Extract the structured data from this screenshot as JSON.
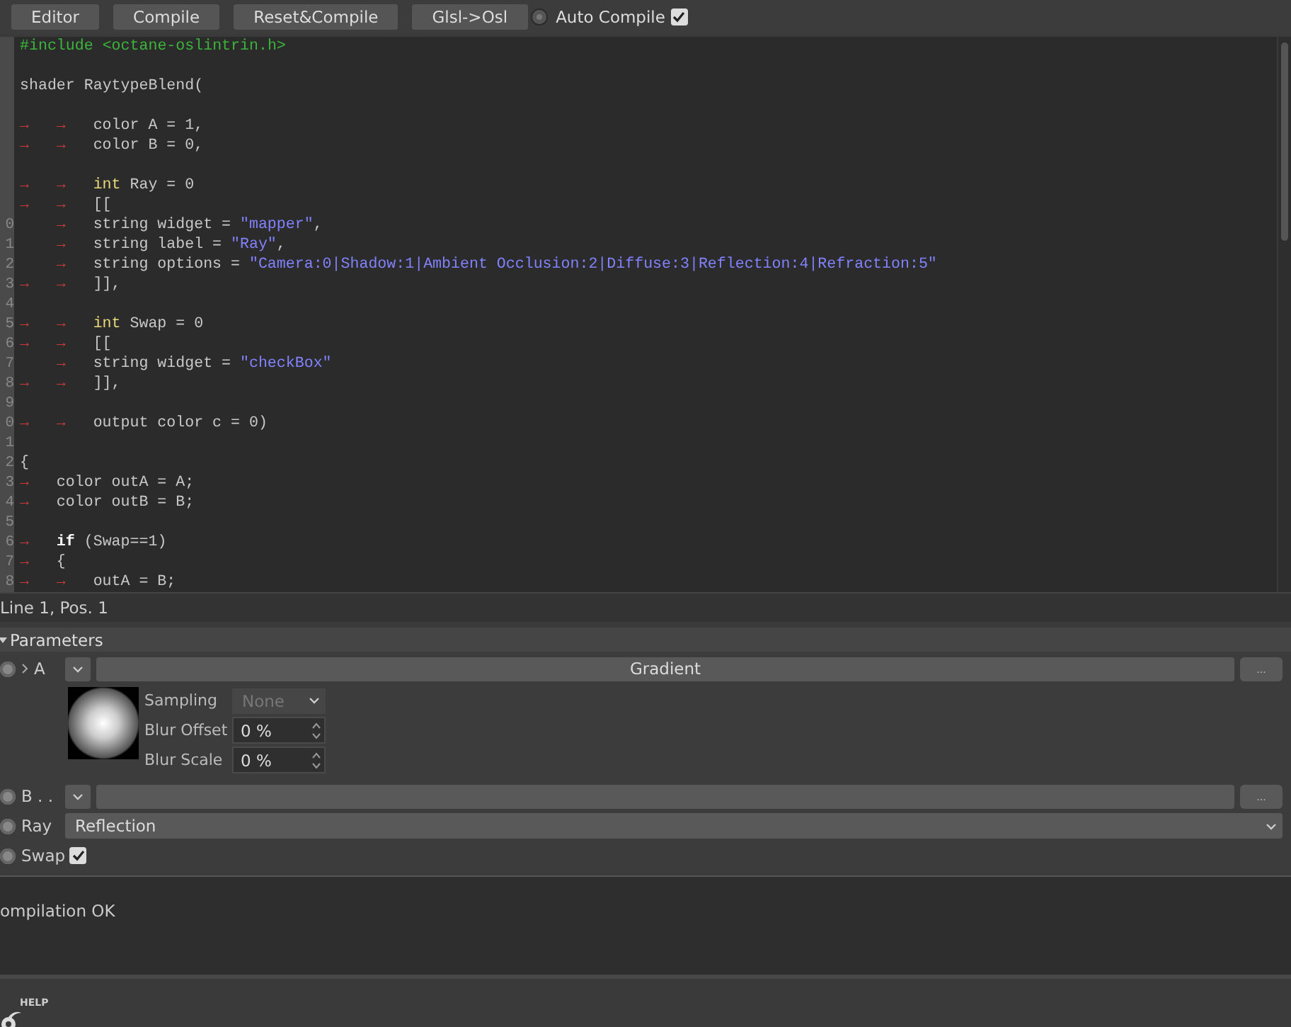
{
  "toolbar": {
    "buttons": [
      "Editor",
      "Compile",
      "Reset&Compile",
      "Glsl->Osl"
    ],
    "toggle": {
      "on": false
    },
    "auto_compile": {
      "label": "Auto Compile",
      "checked": true
    }
  },
  "editor": {
    "lines": [
      {
        "tokens": [
          {
            "kind": "include",
            "text": "#include <octane-oslintrin.h>"
          }
        ]
      },
      {
        "kind": "blank"
      },
      {
        "tokens": [
          {
            "kind": "plain",
            "text": "shader RaytypeBlend("
          }
        ]
      },
      {
        "kind": "blank"
      },
      {
        "tokens": [
          {
            "kind": "tab",
            "text": "→"
          },
          {
            "kind": "tab",
            "text": "→"
          },
          {
            "kind": "plain",
            "text": "color A = 1,"
          }
        ]
      },
      {
        "tokens": [
          {
            "kind": "tab",
            "text": "→"
          },
          {
            "kind": "tab",
            "text": "→"
          },
          {
            "kind": "plain",
            "text": "color B = 0,"
          }
        ]
      },
      {
        "kind": "blank"
      },
      {
        "tokens": [
          {
            "kind": "tab",
            "text": "→"
          },
          {
            "kind": "tab",
            "text": "→"
          },
          {
            "kind": "type",
            "text": "int"
          },
          {
            "kind": "plain",
            "text": " Ray = 0"
          }
        ]
      },
      {
        "tokens": [
          {
            "kind": "tab",
            "text": "→"
          },
          {
            "kind": "tab",
            "text": "→"
          },
          {
            "kind": "plain",
            "text": "[["
          }
        ]
      },
      {
        "gutter": "0",
        "indented": true,
        "tokens": [
          {
            "kind": "tab",
            "text": "→"
          },
          {
            "kind": "plain",
            "text": "string widget = "
          },
          {
            "kind": "string",
            "text": "\"mapper\""
          },
          {
            "kind": "plain",
            "text": ","
          }
        ]
      },
      {
        "gutter": "1",
        "indented": true,
        "tokens": [
          {
            "kind": "tab",
            "text": "→"
          },
          {
            "kind": "plain",
            "text": "string label = "
          },
          {
            "kind": "string",
            "text": "\"Ray\""
          },
          {
            "kind": "plain",
            "text": ","
          }
        ]
      },
      {
        "gutter": "2",
        "indented": true,
        "tokens": [
          {
            "kind": "tab",
            "text": "→"
          },
          {
            "kind": "plain",
            "text": "string options = "
          },
          {
            "kind": "string",
            "text": "\"Camera:0|Shadow:1|Ambient Occlusion:2|Diffuse:3|Reflection:4|Refraction:5\""
          }
        ]
      },
      {
        "gutter": "3",
        "tokens": [
          {
            "kind": "tab",
            "text": "→"
          },
          {
            "kind": "tab",
            "text": "→"
          },
          {
            "kind": "plain",
            "text": "]],"
          }
        ]
      },
      {
        "gutter": "4"
      },
      {
        "gutter": "5",
        "tokens": [
          {
            "kind": "tab",
            "text": "→"
          },
          {
            "kind": "tab",
            "text": "→"
          },
          {
            "kind": "type",
            "text": "int"
          },
          {
            "kind": "plain",
            "text": " Swap = 0"
          }
        ]
      },
      {
        "gutter": "6",
        "tokens": [
          {
            "kind": "tab",
            "text": "→"
          },
          {
            "kind": "tab",
            "text": "→"
          },
          {
            "kind": "plain",
            "text": "[["
          }
        ]
      },
      {
        "gutter": "7",
        "indented": true,
        "tokens": [
          {
            "kind": "tab",
            "text": "→"
          },
          {
            "kind": "plain",
            "text": "string widget = "
          },
          {
            "kind": "string",
            "text": "\"checkBox\""
          }
        ]
      },
      {
        "gutter": "8",
        "tokens": [
          {
            "kind": "tab",
            "text": "→"
          },
          {
            "kind": "tab",
            "text": "→"
          },
          {
            "kind": "plain",
            "text": "]],"
          }
        ]
      },
      {
        "gutter": "9"
      },
      {
        "gutter": "0",
        "tokens": [
          {
            "kind": "tab",
            "text": "→"
          },
          {
            "kind": "tab",
            "text": "→"
          },
          {
            "kind": "plain",
            "text": "output color c = 0)"
          }
        ]
      },
      {
        "gutter": "1"
      },
      {
        "gutter": "2",
        "tokens": [
          {
            "kind": "plain",
            "text": "{"
          }
        ]
      },
      {
        "gutter": "3",
        "tokens": [
          {
            "kind": "tab",
            "text": "→"
          },
          {
            "kind": "plain",
            "text": "color outA = A;"
          }
        ]
      },
      {
        "gutter": "4",
        "tokens": [
          {
            "kind": "tab",
            "text": "→"
          },
          {
            "kind": "plain",
            "text": "color outB = B;"
          }
        ]
      },
      {
        "gutter": "5"
      },
      {
        "gutter": "6",
        "tokens": [
          {
            "kind": "tab",
            "text": "→"
          },
          {
            "kind": "keyword",
            "text": "if"
          },
          {
            "kind": "plain",
            "text": " (Swap==1)"
          }
        ]
      },
      {
        "gutter": "7",
        "tokens": [
          {
            "kind": "tab",
            "text": "→"
          },
          {
            "kind": "plain",
            "text": "{"
          }
        ]
      },
      {
        "gutter": "8",
        "tokens": [
          {
            "kind": "tab",
            "text": "→"
          },
          {
            "kind": "tab",
            "text": "→"
          },
          {
            "kind": "plain",
            "text": "outA = B;"
          }
        ]
      }
    ]
  },
  "status": "Line 1, Pos. 1",
  "parameters": {
    "title": "Parameters",
    "expanded": true,
    "rows": [
      {
        "kind": "shader",
        "on": false,
        "label": "A",
        "value": "Gradient",
        "more": "...",
        "preview": {
          "fields": [
            {
              "kind": "select",
              "label": "Sampling",
              "value": "None",
              "disabled": true
            },
            {
              "kind": "spin",
              "label": "Blur Offset",
              "value": "0 %"
            },
            {
              "kind": "spin",
              "label": "Blur Scale",
              "value": "0 %"
            }
          ]
        }
      },
      {
        "kind": "shader",
        "on": false,
        "label": "B . .",
        "more": "..."
      },
      {
        "kind": "dropdown",
        "on": false,
        "label": "Ray",
        "value": "Reflection"
      },
      {
        "kind": "checkbox",
        "on": false,
        "label": "Swap",
        "checked": true
      }
    ]
  },
  "output": "ompilation OK",
  "help": {
    "label": "HELP"
  }
}
